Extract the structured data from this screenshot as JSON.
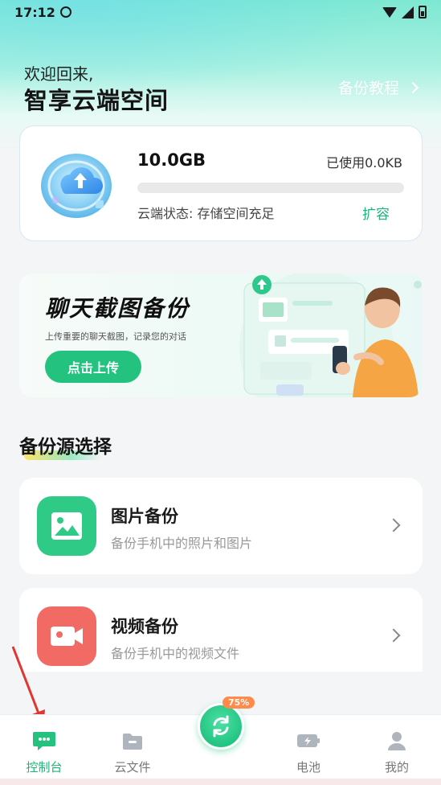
{
  "status_bar": {
    "time": "17:12"
  },
  "header": {
    "welcome": "欢迎回来,",
    "brand": "智享云端空间",
    "tutorial": "备份教程"
  },
  "storage": {
    "total": "10.0GB",
    "used": "已使用0.0KB",
    "used_fraction": 0.0,
    "status": "云端状态: 存储空间充足",
    "expand": "扩容"
  },
  "banner": {
    "title": "聊天截图备份",
    "subtitle": "上传重要的聊天截图，记录您的对话",
    "button": "点击上传"
  },
  "section": {
    "title": "备份源选择"
  },
  "sources": [
    {
      "title": "图片备份",
      "subtitle": "备份手机中的照片和图片",
      "icon": "image-icon",
      "color": "#2fcb86"
    },
    {
      "title": "视频备份",
      "subtitle": "备份手机中的视频文件",
      "icon": "video-camera-icon",
      "color": "#f26a64"
    }
  ],
  "tabs": [
    {
      "label": "控制台",
      "icon": "chat-bubble-icon",
      "active": true
    },
    {
      "label": "云文件",
      "icon": "folder-icon",
      "active": false
    },
    {
      "label": "电池",
      "icon": "battery-icon",
      "active": false
    },
    {
      "label": "我的",
      "icon": "user-icon",
      "active": false
    }
  ],
  "center_action": {
    "badge": "75%",
    "icon": "sync-icon"
  },
  "colors": {
    "accent": "#23c27f",
    "video": "#f26a64",
    "annotation_arrow": "#e2352f"
  }
}
